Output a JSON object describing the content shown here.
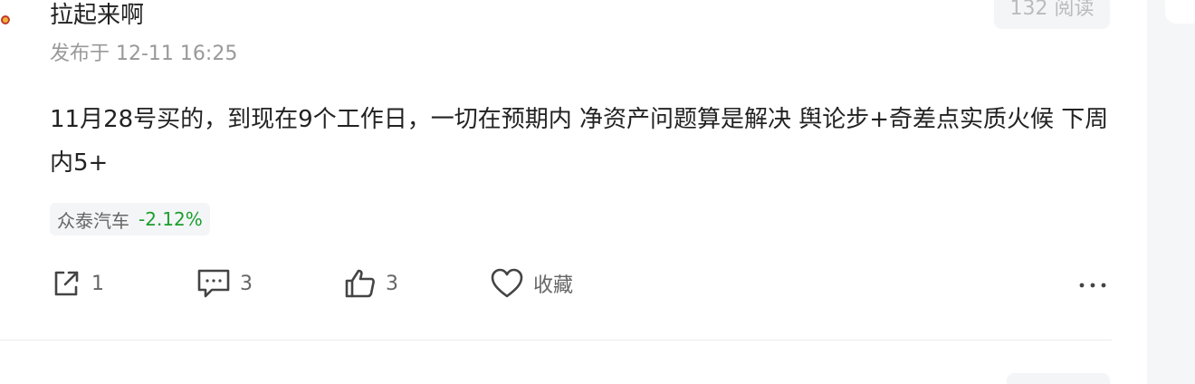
{
  "post": {
    "author": "拉起来啊",
    "published": "发布于 12-11 16:25",
    "read_count": "132 阅读",
    "content": "11月28号买的，到现在9个工作日，一切在预期内 净资产问题算是解决 舆论步+奇差点实质火候 下周内5+",
    "stock": {
      "name": "众泰汽车",
      "change": "-2.12%",
      "change_color": "#1a9e2c"
    }
  },
  "actions": {
    "share_count": "1",
    "comment_count": "3",
    "like_count": "3",
    "favorite_label": "收藏",
    "icons": [
      "share-icon",
      "comment-icon",
      "thumbs-up-icon",
      "heart-icon",
      "more-icon"
    ]
  }
}
